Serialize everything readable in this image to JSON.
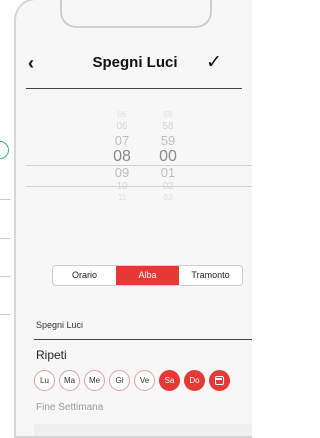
{
  "header": {
    "back_icon": "‹",
    "title": "Spegni Luci",
    "confirm_icon": "✓"
  },
  "picker": {
    "hours": [
      "06",
      "06",
      "07",
      "08",
      "09",
      "10",
      "11"
    ],
    "minutes": [
      "58",
      "58",
      "59",
      "00",
      "01",
      "02",
      "03"
    ],
    "selected_hour": "08",
    "selected_minute": "00"
  },
  "segments": [
    "Orario",
    "Alba",
    "Tramonto"
  ],
  "active_segment": "Alba",
  "field": {
    "label": "Spegni Luci"
  },
  "repeat": {
    "label": "Ripeti",
    "days": [
      {
        "label": "Lu",
        "active": false
      },
      {
        "label": "Ma",
        "active": false
      },
      {
        "label": "Me",
        "active": false
      },
      {
        "label": "Gi",
        "active": false
      },
      {
        "label": "Ve",
        "active": false
      },
      {
        "label": "Sa",
        "active": true
      },
      {
        "label": "Do",
        "active": true
      }
    ],
    "calendar_icon": "calendar-icon",
    "preset": "Fine Settimana"
  },
  "colors": {
    "accent": "#e53935",
    "background": "#f7f7f7"
  }
}
